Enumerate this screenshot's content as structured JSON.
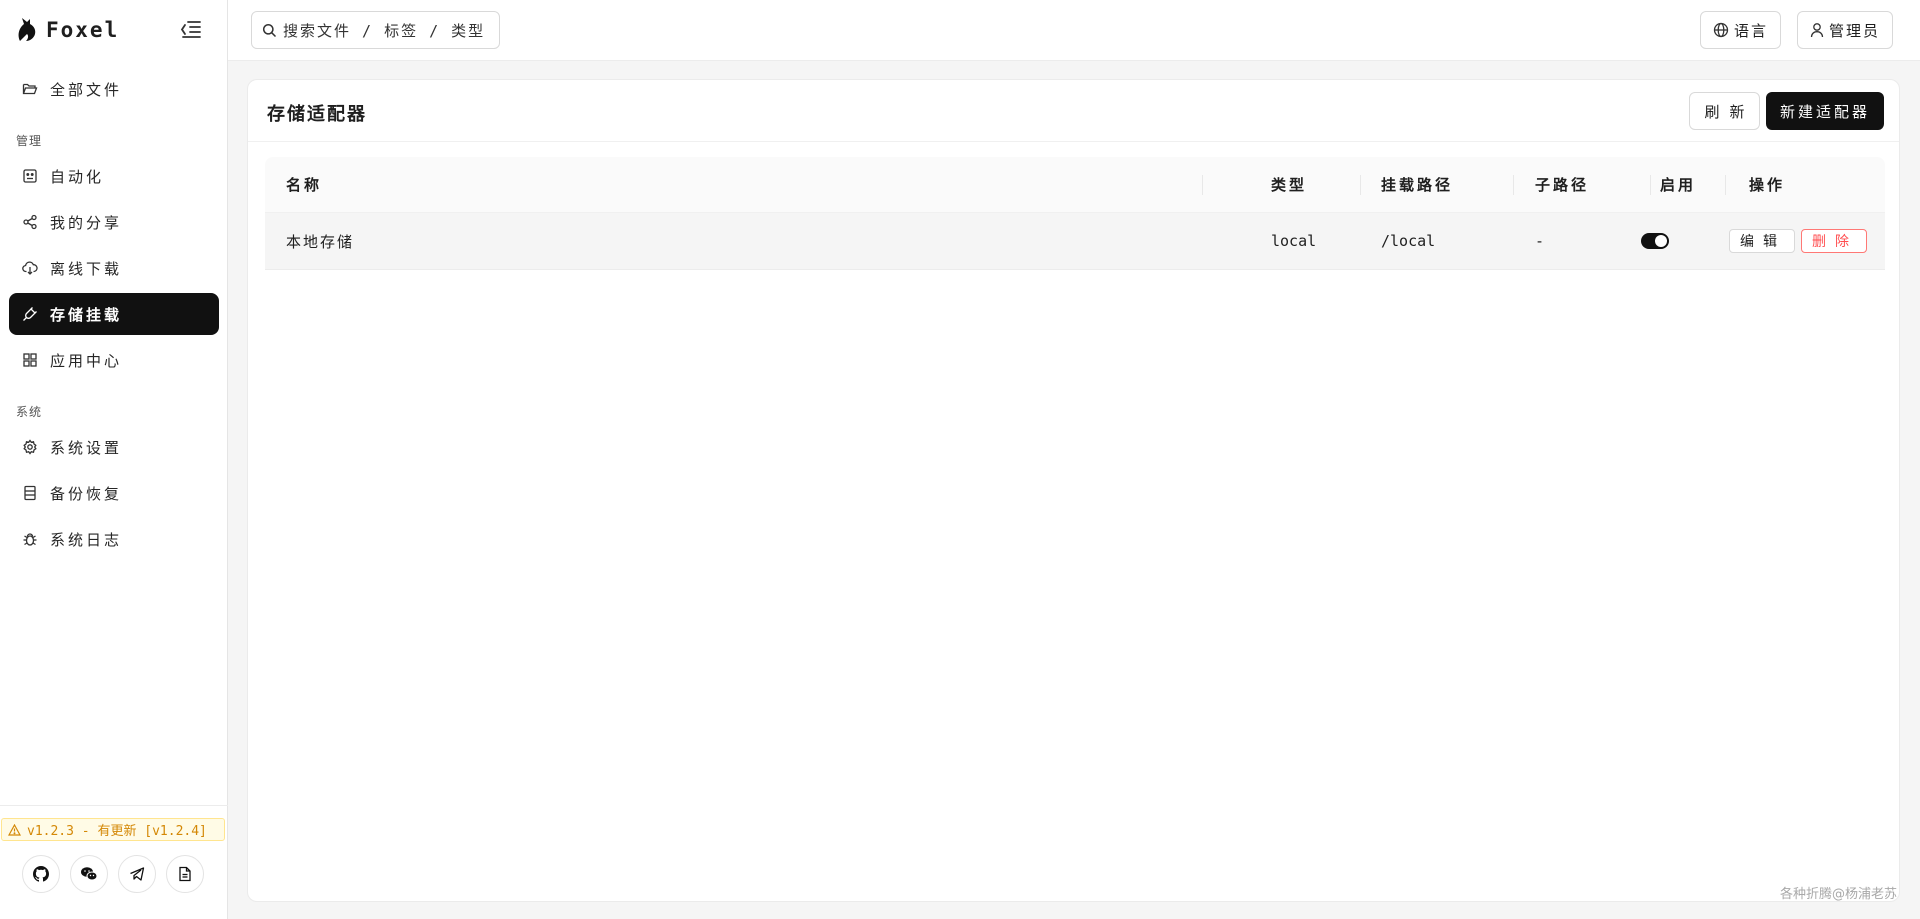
{
  "app": {
    "name": "Foxel"
  },
  "sidebar": {
    "all_files": "全部文件",
    "section_manage": "管理",
    "manage_items": [
      "自动化",
      "我的分享",
      "离线下载",
      "存储挂载",
      "应用中心"
    ],
    "section_system": "系统",
    "system_items": [
      "系统设置",
      "备份恢复",
      "系统日志"
    ],
    "active_item": "存储挂载",
    "update_notice": "v1.2.3 - 有更新 [v1.2.4]"
  },
  "header": {
    "search_placeholder": "搜索文件 / 标签 / 类型",
    "language_label": "语言",
    "user_label": "管理员"
  },
  "main": {
    "title": "存储适配器",
    "refresh_label": "刷新",
    "new_label": "新建适配器",
    "table": {
      "columns": [
        "名称",
        "类型",
        "挂载路径",
        "子路径",
        "启用",
        "操作"
      ],
      "rows": [
        {
          "name": "本地存储",
          "type": "local",
          "mount_path": "/local",
          "sub_path": "-",
          "enabled": true,
          "edit": "编辑",
          "delete": "删除"
        }
      ]
    }
  },
  "watermark": "各种折腾@杨浦老苏",
  "colors": {
    "accent": "#111111",
    "danger": "#ff4d4f",
    "warning": "#d48806"
  }
}
